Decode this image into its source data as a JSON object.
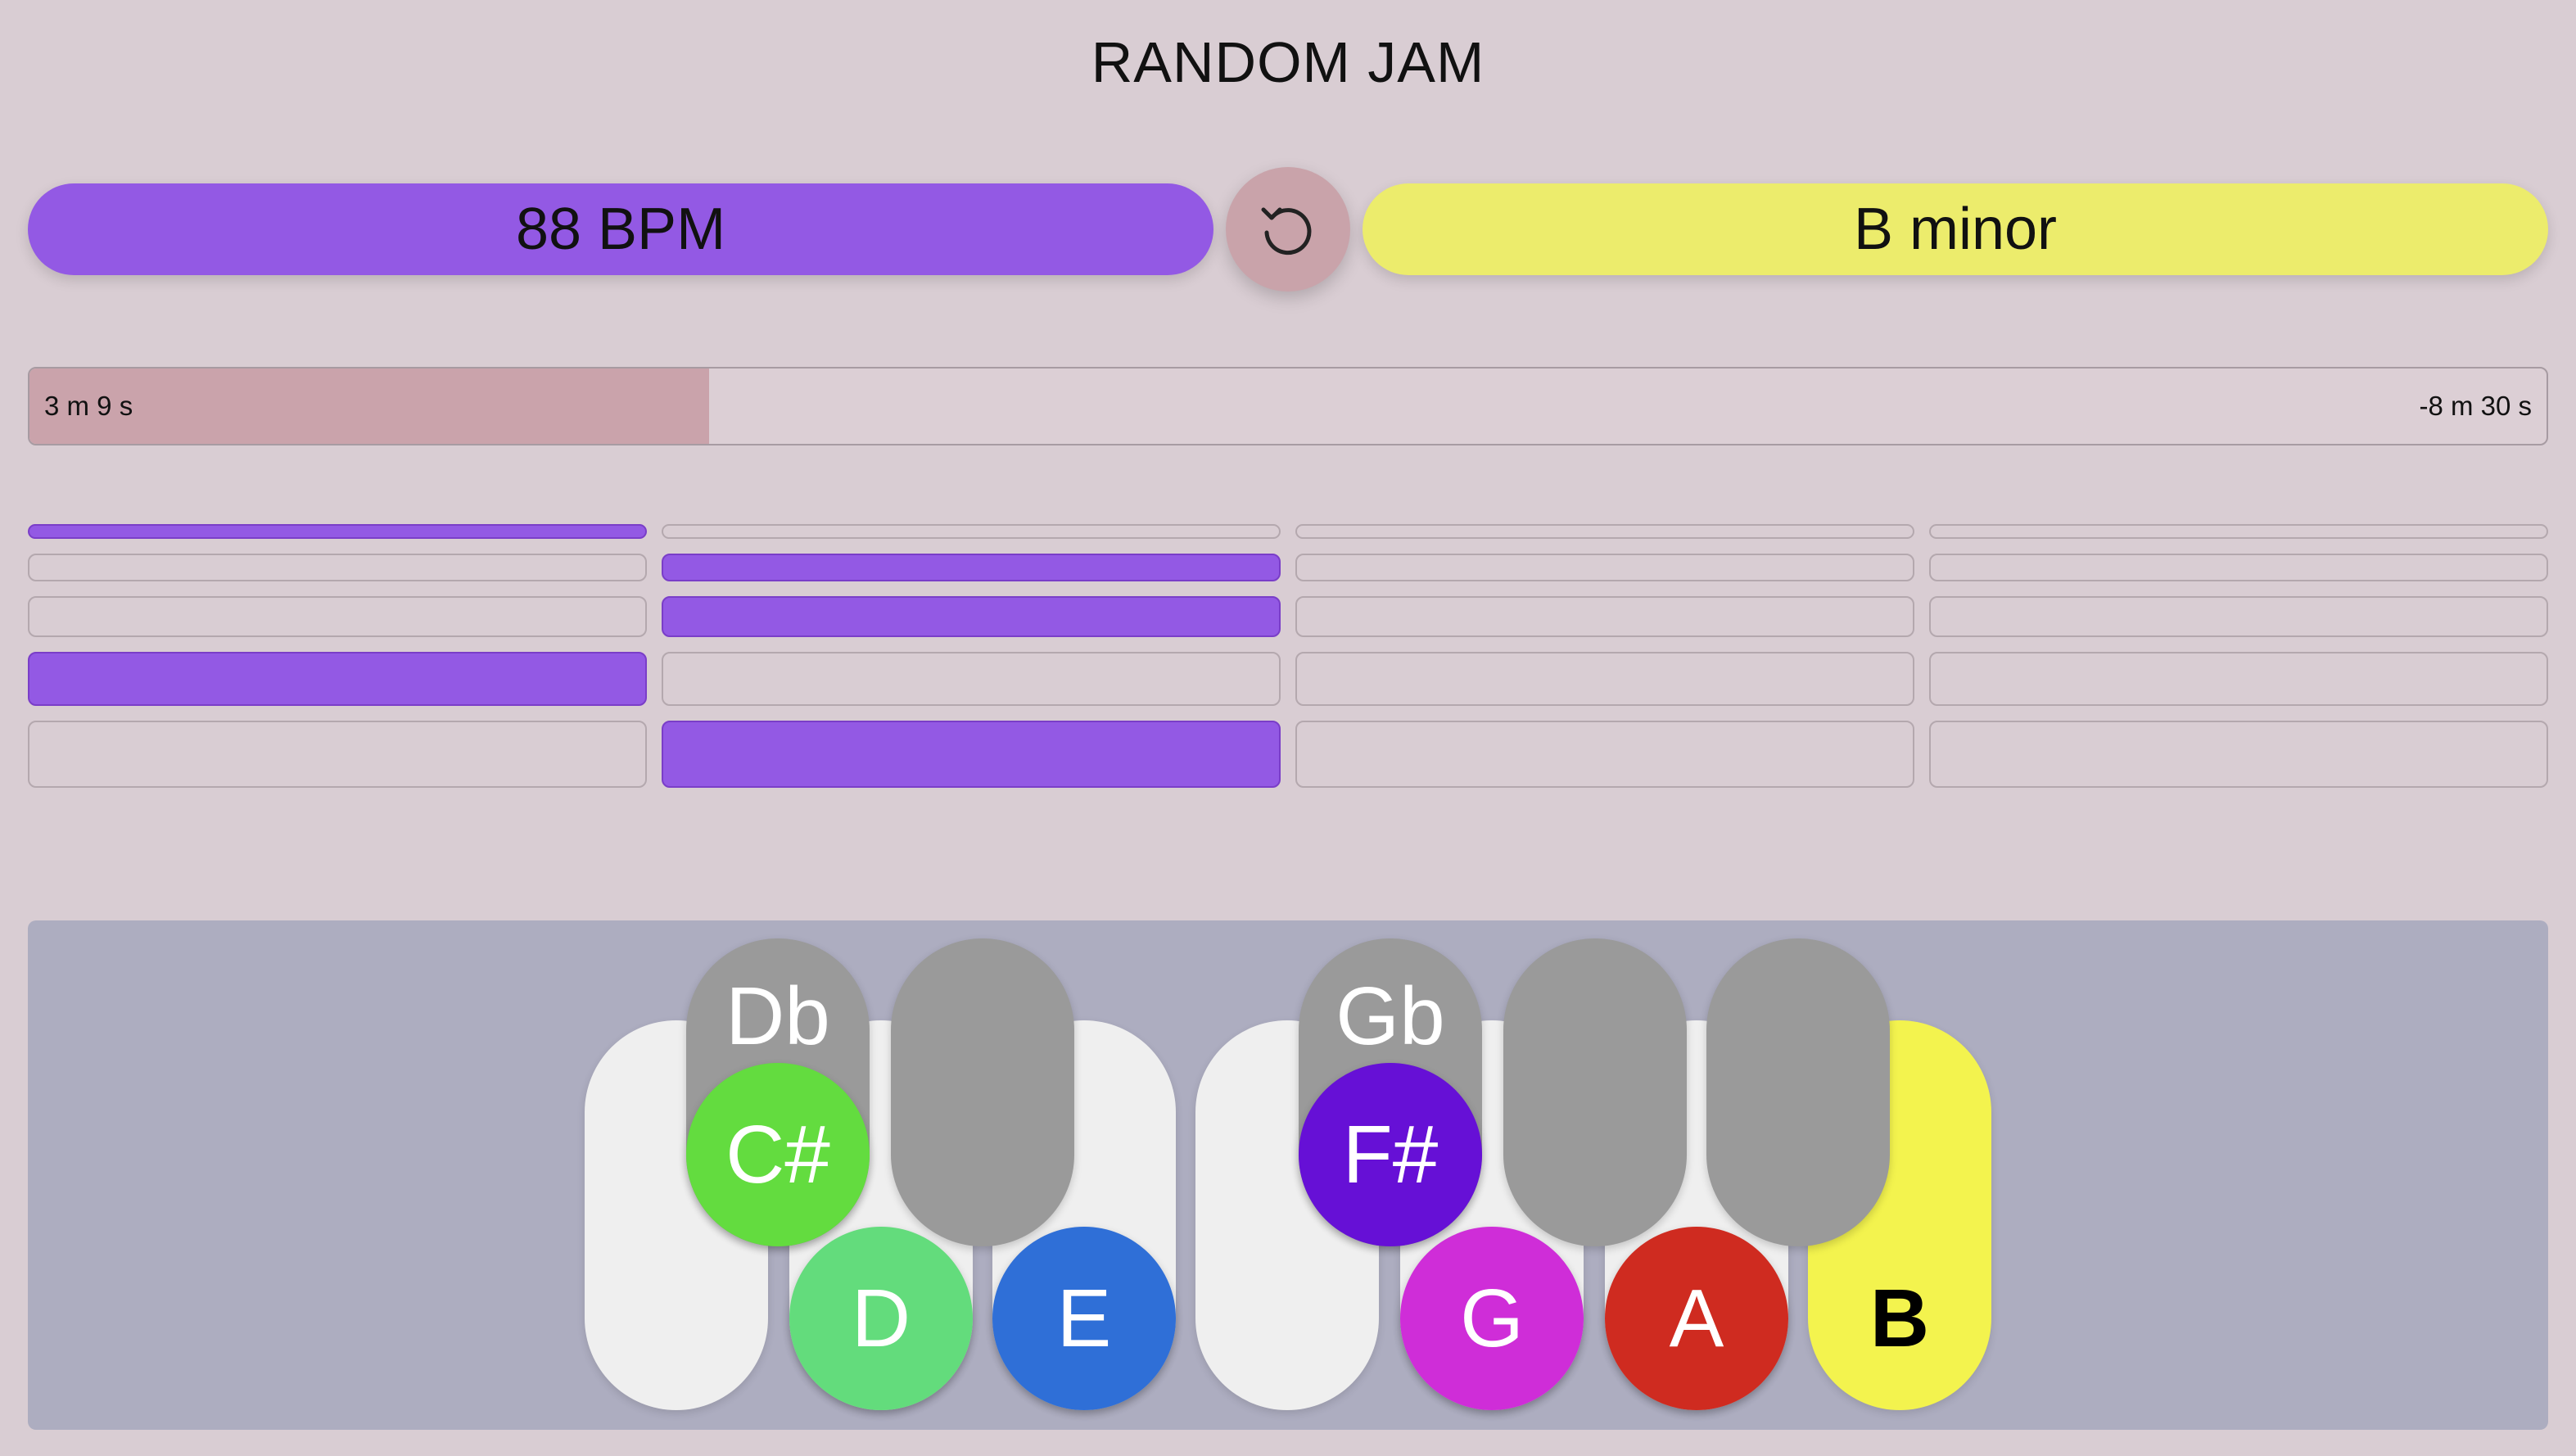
{
  "title": "RANDOM JAM",
  "tempo_label": "88 BPM",
  "key_label": "B minor",
  "refresh_icon": "refresh-icon",
  "progress": {
    "elapsed": "3 m 9 s",
    "remaining": "-8 m 30 s",
    "fraction": 0.27
  },
  "pattern_rows": [
    [
      true,
      false,
      false,
      false
    ],
    [
      false,
      true,
      false,
      false
    ],
    [
      false,
      true,
      false,
      false
    ],
    [
      true,
      false,
      false,
      false
    ],
    [
      false,
      true,
      false,
      false
    ]
  ],
  "colors": {
    "tempo": "#9359e4",
    "key": "#ecec6c",
    "note_csharp": "#63dc3f",
    "note_d": "#63dc7c",
    "note_e": "#2f6fd7",
    "note_fsharp": "#6610d6",
    "note_g": "#cf2dd8",
    "note_a": "#cf2b20",
    "note_b": "#f3f34e"
  },
  "piano": {
    "black_keys": [
      {
        "flat": "Db",
        "sharp": "C#",
        "active": true
      },
      {
        "flat": "",
        "sharp": "",
        "active": false
      },
      {
        "flat": "Gb",
        "sharp": "F#",
        "active": true
      },
      {
        "flat": "",
        "sharp": "",
        "active": false
      },
      {
        "flat": "",
        "sharp": "",
        "active": false
      }
    ],
    "white_notes": [
      "D",
      "E",
      "G",
      "A",
      "B"
    ]
  }
}
